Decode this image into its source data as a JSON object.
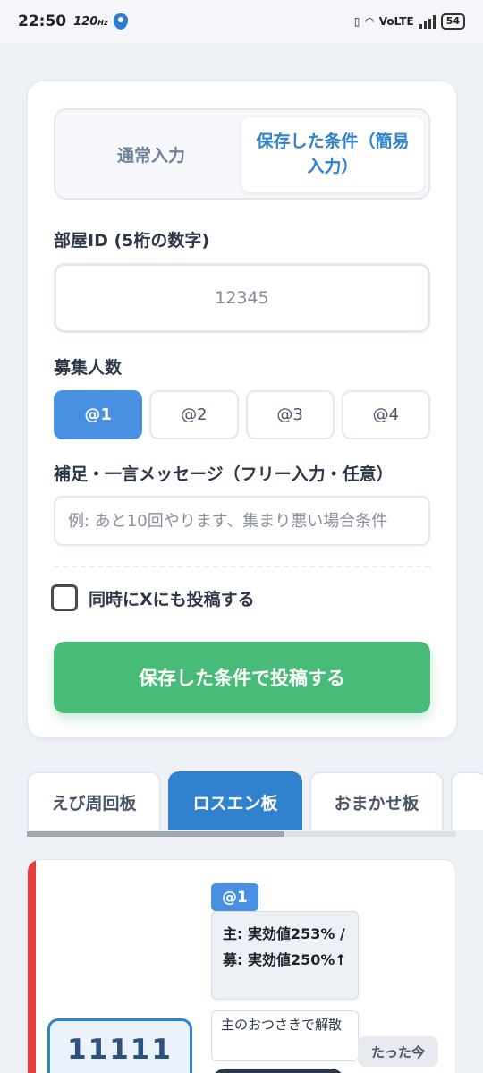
{
  "status_bar": {
    "time": "22:50",
    "refresh_rate": "120",
    "network": "VoLTE",
    "battery": "54"
  },
  "form": {
    "mode_tabs": {
      "normal": "通常入力",
      "saved": "保存した条件（簡易入力）",
      "active": "saved"
    },
    "room_id": {
      "label": "部屋ID (5桁の数字)",
      "placeholder": "12345"
    },
    "people": {
      "label": "募集人数",
      "options": [
        "@1",
        "@2",
        "@3",
        "@4"
      ],
      "selected": "@1"
    },
    "message": {
      "label": "補足・一言メッセージ（フリー入力・任意）",
      "placeholder": "例: あと10回やります、集まり悪い場合条件"
    },
    "post_to_x": {
      "label": "同時にXにも投稿する",
      "checked": false
    },
    "submit_label": "保存した条件で投稿する"
  },
  "boards": {
    "tabs": [
      "えび周回板",
      "ロスエン板",
      "おまかせ板"
    ],
    "active": "ロスエン板"
  },
  "post": {
    "accent_color": "#e53e3e",
    "badge": "@1",
    "condition": "主: 実効値253% / 募: 実効値250%↑",
    "note": "主のおつさきで解散",
    "time": "たった今",
    "room_id": "11111"
  }
}
